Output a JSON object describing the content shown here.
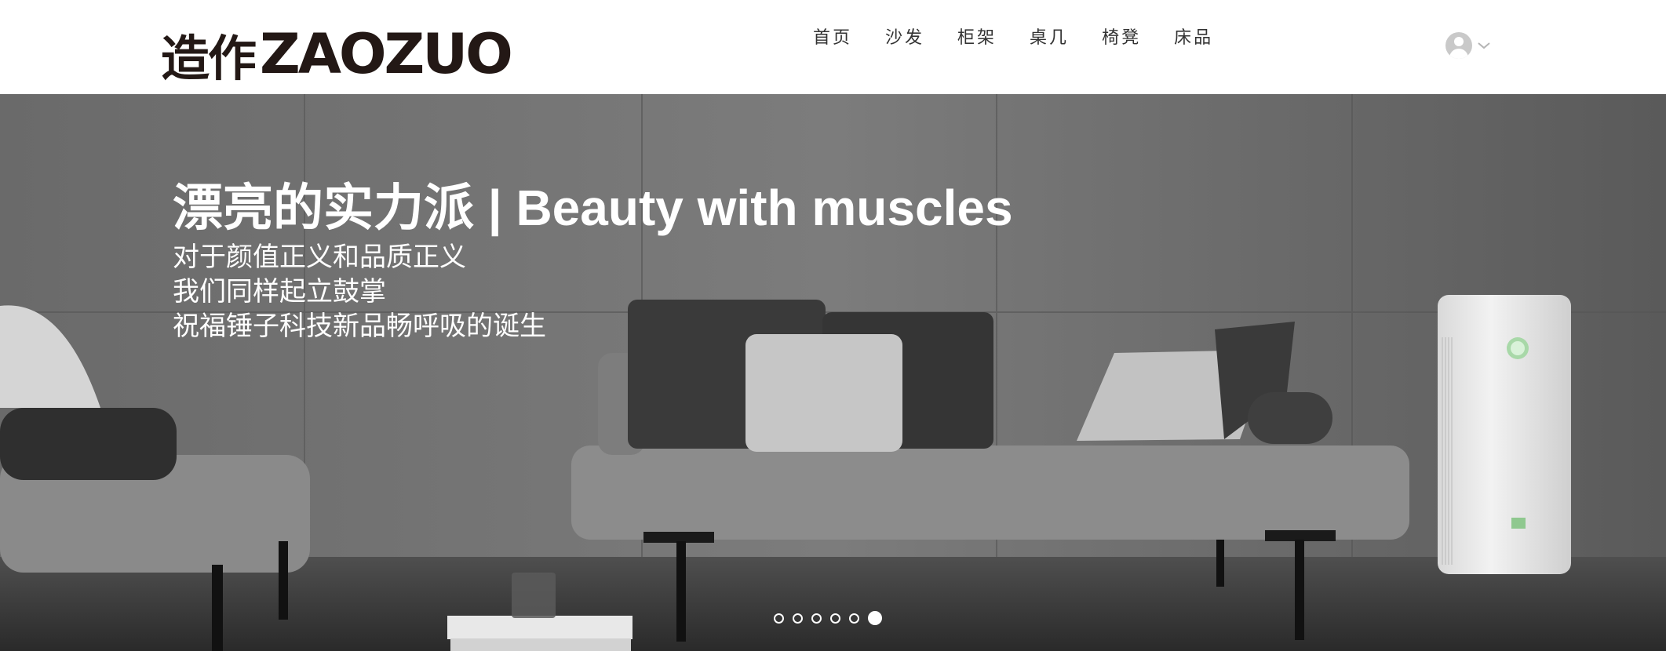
{
  "header": {
    "logo_cn": "造作",
    "logo_en": "ZAOZUO",
    "nav": [
      {
        "label": "首页"
      },
      {
        "label": "沙发"
      },
      {
        "label": "柜架"
      },
      {
        "label": "桌几"
      },
      {
        "label": "椅凳"
      },
      {
        "label": "床品"
      }
    ],
    "user_icon": "user-avatar-icon",
    "dropdown_icon": "chevron-down-icon"
  },
  "banner": {
    "headline": "漂亮的实力派 | Beauty with muscles",
    "lines": [
      "对于颜值正义和品质正义",
      "我们同样起立鼓掌",
      "祝福锤子科技新品畅呼吸的诞生"
    ],
    "carousel": {
      "total": 6,
      "active_index": 6
    }
  },
  "colors": {
    "logo": "#231815",
    "nav_text": "#333333",
    "banner_text": "#ffffff"
  }
}
